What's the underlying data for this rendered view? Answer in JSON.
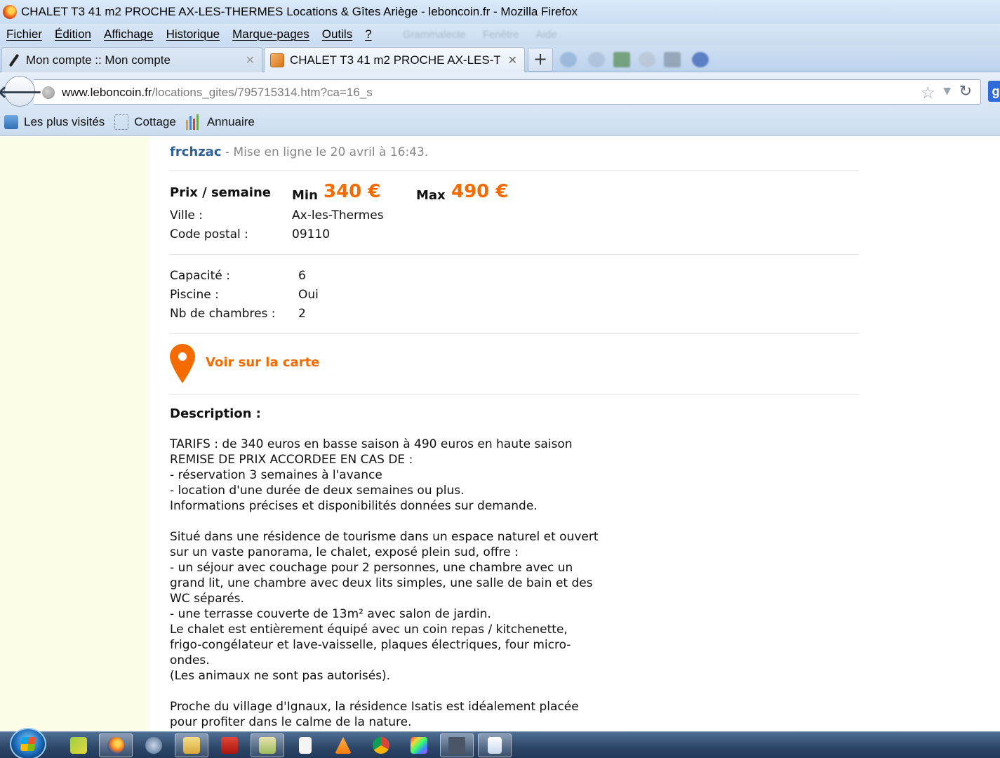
{
  "window": {
    "title": "CHALET T3 41 m2 PROCHE AX-LES-THERMES Locations & Gîtes Ariège - leboncoin.fr - Mozilla Firefox"
  },
  "menubar": {
    "items": [
      "Fichier",
      "Édition",
      "Affichage",
      "Historique",
      "Marque-pages",
      "Outils",
      "?"
    ],
    "faded_items": [
      "Grammalecte",
      "Fenêtre",
      "Aide"
    ]
  },
  "tabs": [
    {
      "label": "Mon compte :: Mon compte",
      "icon": "feather-icon",
      "active": false
    },
    {
      "label": "CHALET T3 41 m2 PROCHE AX-LES-T...",
      "icon": "cube-icon",
      "active": true
    }
  ],
  "newtab_label": "+",
  "navbar": {
    "url_domain": "www.leboncoin.fr",
    "url_path": "/locations_gites/795715314.htm?ca=16_s",
    "search_engine_label": "g"
  },
  "bookmarks": [
    {
      "label": "Les plus visités",
      "icon": "most-visited-icon"
    },
    {
      "label": "Cottage",
      "icon": "cottage-icon"
    },
    {
      "label": "Annuaire",
      "icon": "annuaire-icon"
    }
  ],
  "listing": {
    "user": "frchzac",
    "posted": " - Mise en ligne le 20 avril à 16:43.",
    "price_label": "Prix / semaine",
    "min_label": "Min",
    "min_price": "340 €",
    "max_label": "Max",
    "max_price": "490 €",
    "ville_label": "Ville :",
    "ville_value": "Ax-les-Thermes",
    "cp_label": "Code postal :",
    "cp_value": "09110",
    "capacite_label": "Capacité :",
    "capacite_value": "6",
    "piscine_label": "Piscine :",
    "piscine_value": "Oui",
    "chambres_label": "Nb de chambres :",
    "chambres_value": "2",
    "map_link": "Voir sur la carte",
    "description_title": "Description :",
    "description_lines": [
      "TARIFS : de 340 euros en basse saison à 490 euros en haute saison",
      "REMISE DE PRIX ACCORDEE EN CAS DE :",
      "- réservation 3 semaines à l'avance",
      "- location d'une durée de deux semaines ou plus.",
      "Informations précises et disponibilités données sur demande.",
      "",
      "Situé dans une résidence de tourisme dans un espace naturel et ouvert",
      "sur un vaste panorama, le chalet, exposé plein sud, offre :",
      "- un séjour avec couchage pour 2 personnes, une chambre avec un",
      "grand lit, une chambre avec deux lits simples, une salle de bain et des",
      "WC séparés.",
      "- une terrasse couverte de 13m² avec salon de jardin.",
      "Le chalet est entièrement équipé avec un coin repas / kitchenette,",
      "frigo-congélateur et lave-vaisselle, plaques électriques, four micro-",
      "ondes.",
      "(Les animaux ne sont pas autorisés).",
      "",
      "Proche du village d'Ignaux, la résidence Isatis est idéalement placée",
      "pour profiter dans le calme de la nature."
    ]
  },
  "colors": {
    "price": "#f56b00",
    "user_link": "#2f5f97",
    "left_margin": "#fdfde8"
  },
  "taskbar": {
    "items": [
      "firefox",
      "network",
      "explorer",
      "acrobat",
      "contacts",
      "document",
      "vlc",
      "chrome",
      "color-tool",
      "twp",
      "wordpad"
    ]
  }
}
